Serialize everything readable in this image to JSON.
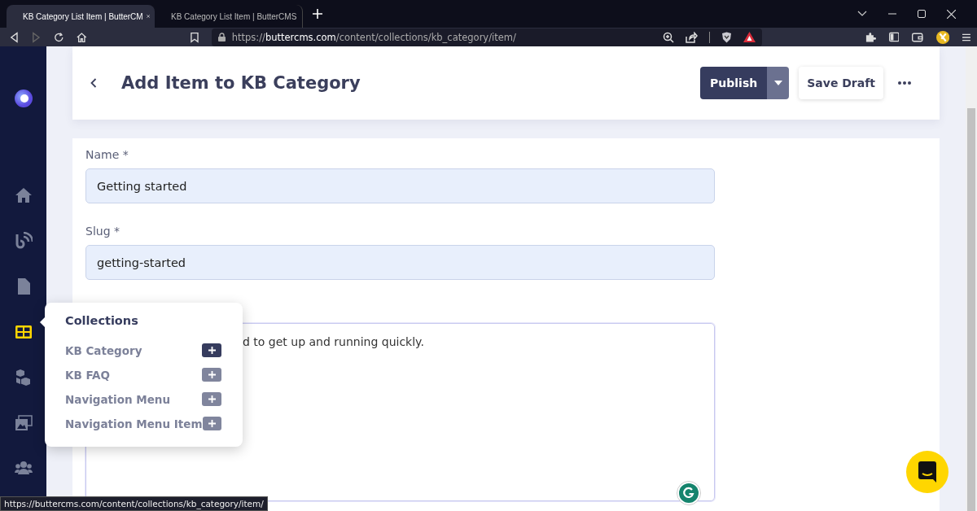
{
  "browser": {
    "tabs": [
      {
        "title": "KB Category List Item | ButterCM",
        "selected": true
      },
      {
        "title": "KB Category List Item | ButterCMS",
        "selected": false
      }
    ],
    "nav": {
      "forward_disabled": true
    },
    "url": {
      "prefix": "https://",
      "host": "buttercms.com",
      "path": "/content/collections/kb_category/item/"
    }
  },
  "sidebar": {
    "items": [
      {
        "kind": "home",
        "selected": false
      },
      {
        "kind": "blog",
        "selected": false
      },
      {
        "kind": "page",
        "selected": false
      },
      {
        "kind": "collections",
        "selected": true
      },
      {
        "kind": "components",
        "selected": false
      },
      {
        "kind": "media",
        "selected": false
      },
      {
        "kind": "users",
        "selected": false
      }
    ]
  },
  "header": {
    "title": "Add Item to KB Category",
    "publish": "Publish",
    "save_draft": "Save Draft"
  },
  "form": {
    "fields": [
      {
        "kind": "input",
        "label": "Name *",
        "value": "Getting started"
      },
      {
        "kind": "input",
        "label": "Slug *",
        "value": "getting-started"
      },
      {
        "kind": "textarea",
        "value": "d to get up and running quickly."
      }
    ]
  },
  "collections_menu": {
    "title": "Collections",
    "items": [
      {
        "label": "KB Category",
        "selected": true
      },
      {
        "label": "KB FAQ",
        "selected": false
      },
      {
        "label": "Navigation Menu",
        "selected": false
      },
      {
        "label": "Navigation Menu Item",
        "selected": false
      }
    ]
  },
  "status_url": "https://buttercms.com/content/collections/kb_category/item/"
}
